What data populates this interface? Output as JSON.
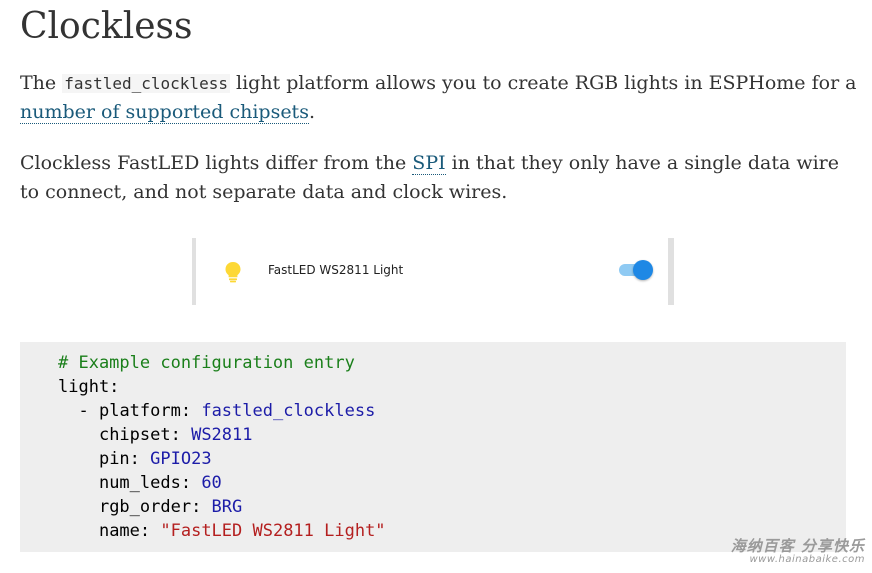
{
  "page": {
    "title": "Clockless"
  },
  "intro": {
    "p1_prefix": "The ",
    "p1_code": "fastled_clockless",
    "p1_mid": " light platform allows you to create RGB lights in ESPHome for a ",
    "p1_link": "number of supported chipsets",
    "p1_suffix": ".",
    "p2_prefix": "Clockless FastLED lights differ from the ",
    "p2_link": "SPI",
    "p2_suffix": " in that they only have a single data wire to connect, and not separate data and clock wires."
  },
  "device_card": {
    "icon": "lightbulb-icon",
    "icon_color": "#fdd835",
    "name": "FastLED WS2811 Light",
    "toggle_on": true,
    "toggle_color": "#1e88e5"
  },
  "code": {
    "comment": "# Example configuration entry",
    "root_key": "light:",
    "dash": "- ",
    "platform_key": "platform: ",
    "platform_val": "fastled_clockless",
    "chipset_key": "chipset: ",
    "chipset_val": "WS2811",
    "pin_key": "pin: ",
    "pin_val": "GPIO23",
    "num_leds_key": "num_leds: ",
    "num_leds_val": "60",
    "rgb_order_key": "rgb_order: ",
    "rgb_order_val": "BRG",
    "name_key": "name: ",
    "name_val": "\"FastLED WS2811 Light\""
  },
  "watermark": {
    "main": "海纳百客 分享快乐",
    "sub": "www.hainabaike.com"
  }
}
